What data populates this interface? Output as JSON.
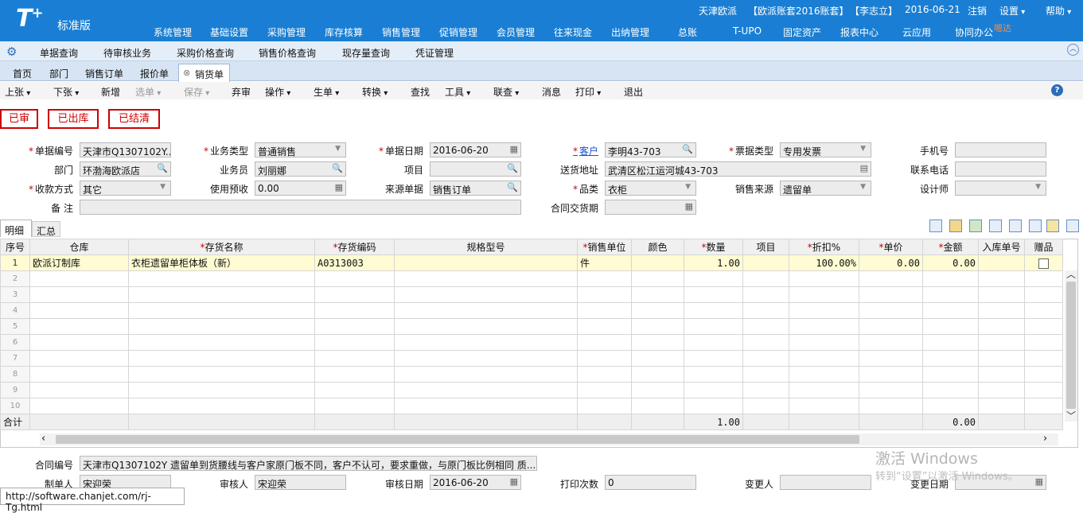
{
  "header": {
    "logo": "T",
    "logo_plus": "+",
    "edition": "标准版",
    "company": "天津欧派",
    "account": "【欧派账套2016账套】",
    "user": "【李志立】",
    "date": "2016-06-21",
    "logout": "注销",
    "settings": "设置",
    "help": "帮助",
    "menu": [
      "系统管理",
      "基础设置",
      "采购管理",
      "库存核算",
      "销售管理",
      "促销管理",
      "会员管理",
      "往来现金",
      "出纳管理",
      "总账",
      "T-UPO",
      "固定资产",
      "报表中心",
      "云应用",
      "协同办公"
    ],
    "hint_badge": "嗯达"
  },
  "subnav": [
    "单据查询",
    "待审核业务",
    "采购价格查询",
    "销售价格查询",
    "现存量查询",
    "凭证管理"
  ],
  "tabs": [
    "首页",
    "部门",
    "销售订单",
    "报价单",
    "销货单"
  ],
  "toolbar": {
    "items": [
      "上张",
      "下张",
      "新增",
      "选单",
      "保存",
      "弃审",
      "操作",
      "生单",
      "转换",
      "查找",
      "工具",
      "联查",
      "消息",
      "打印",
      "退出"
    ]
  },
  "status_buttons": [
    "已审",
    "已出库",
    "已结清"
  ],
  "form": {
    "doc_no_label": "单据编号",
    "doc_no": "天津市Q1307102Y...",
    "biz_type_label": "业务类型",
    "biz_type": "普通销售",
    "doc_date_label": "单据日期",
    "doc_date": "2016-06-20",
    "customer_label": "客户",
    "customer": "李明43-703",
    "invoice_type_label": "票据类型",
    "invoice_type": "专用发票",
    "phone_label": "手机号",
    "phone": "",
    "dept_label": "部门",
    "dept": "环渤海欧派店",
    "salesman_label": "业务员",
    "salesman": "刘丽娜",
    "project_label": "项目",
    "project": "",
    "address_label": "送货地址",
    "address": "武清区松江运河城43-703",
    "contact_phone_label": "联系电话",
    "contact_phone": "",
    "pay_method_label": "收款方式",
    "pay_method": "其它",
    "prepay_label": "使用预收",
    "prepay": "0.00",
    "source_doc_label": "来源单据",
    "source_doc": "销售订单",
    "category_label": "品类",
    "category": "衣柜",
    "sales_source_label": "销售来源",
    "sales_source": "遗留单",
    "designer_label": "设计师",
    "designer": "",
    "remark_label": "备 注",
    "remark": "",
    "contract_date_label": "合同交货期",
    "contract_date": ""
  },
  "detail_tabs": [
    "明细",
    "汇总"
  ],
  "grid": {
    "columns": [
      "序号",
      "仓库",
      "存货名称",
      "存货编码",
      "规格型号",
      "销售单位",
      "颜色",
      "数量",
      "项目",
      "折扣%",
      "单价",
      "金额",
      "入库单号",
      "赠品"
    ],
    "rows": [
      {
        "no": "1",
        "warehouse": "欧派订制库",
        "name": "衣柜遗留单柜体板（新）",
        "code": "A0313003",
        "spec": "",
        "unit": "件",
        "color": "",
        "qty": "1.00",
        "project": "",
        "discount": "100.00%",
        "price": "0.00",
        "amount": "0.00",
        "in_no": ""
      }
    ],
    "empty_row_numbers": [
      "2",
      "3",
      "4",
      "5",
      "6",
      "7",
      "8",
      "9",
      "10"
    ],
    "total_label": "合计",
    "total_qty": "1.00",
    "total_amount": "0.00"
  },
  "footer": {
    "contract_no_label": "合同编号",
    "contract_no": "天津市Q1307102Y  遗留单到货腰线与客户家原门板不同，客户不认可，要求重做，与原门板比例相同  质...",
    "maker_label": "制单人",
    "maker": "宋迎荣",
    "auditor_label": "审核人",
    "auditor": "宋迎荣",
    "audit_date_label": "审核日期",
    "audit_date": "2016-06-20",
    "print_count_label": "打印次数",
    "print_count": "0",
    "changer_label": "变更人",
    "changer": "",
    "change_date_label": "变更日期",
    "change_date": ""
  },
  "watermark": {
    "line1": "激活 Windows",
    "line2": "转到“设置”以激活 Windows。"
  },
  "status_url": "http://software.chanjet.com/rj-Tg.html"
}
